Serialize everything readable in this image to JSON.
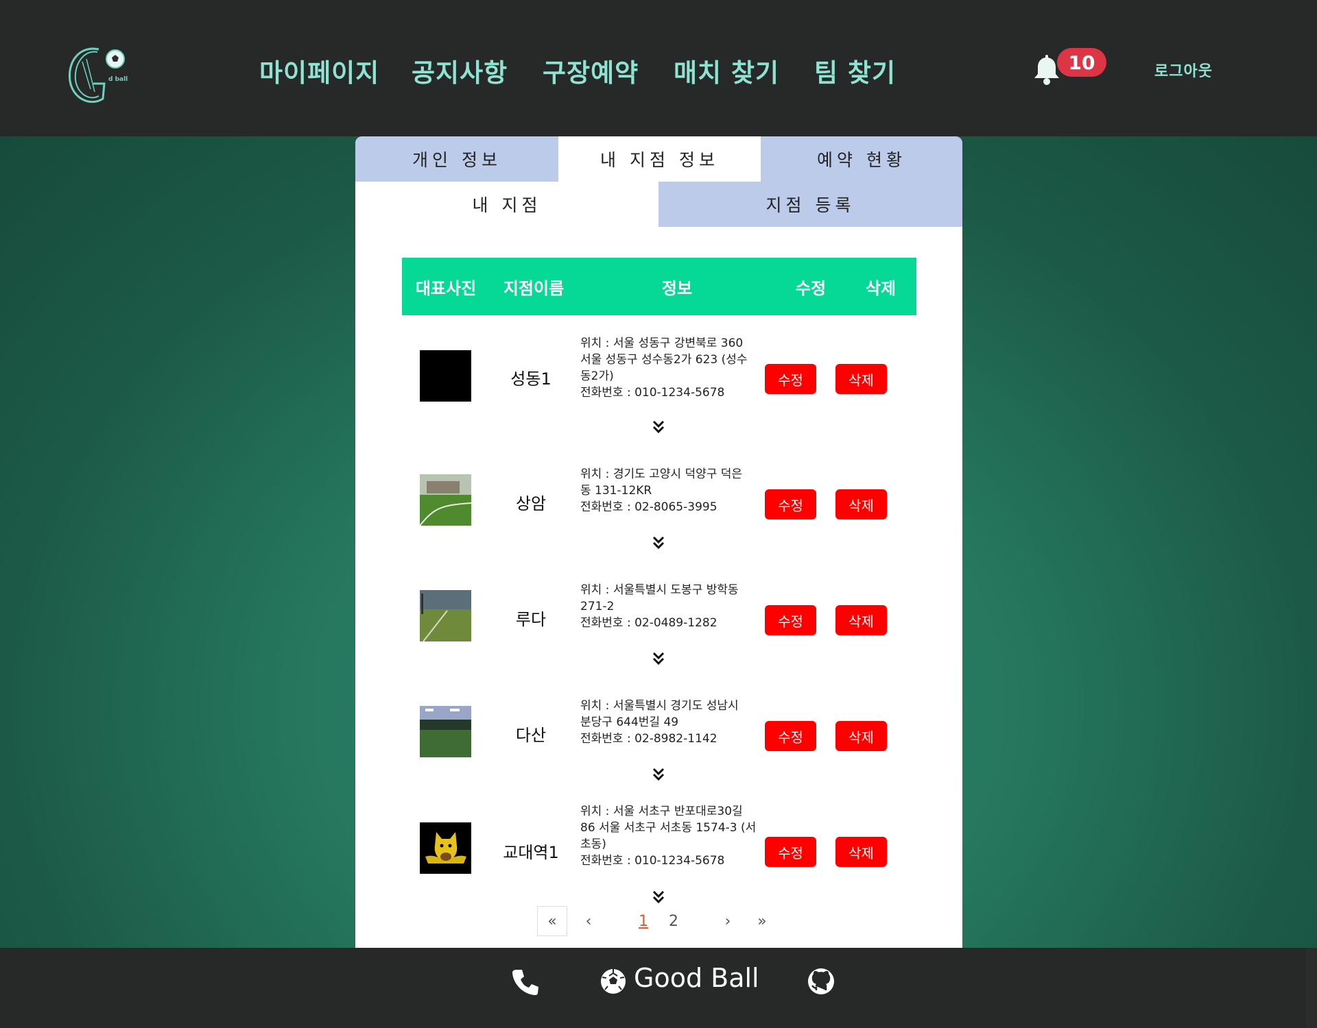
{
  "header": {
    "logo_alt": "Good ball",
    "nav": [
      "마이페이지",
      "공지사항",
      "구장예약",
      "매치 찾기",
      "팀 찾기"
    ],
    "notification_count": "10",
    "logout_label": "로그아웃"
  },
  "tabs": {
    "primary": [
      "개인 정보",
      "내 지점 정보",
      "예약 현황"
    ],
    "primary_active": "내 지점 정보",
    "secondary": [
      "내 지점",
      "지점 등록"
    ],
    "secondary_active": "내 지점"
  },
  "table": {
    "headers": [
      "대표사진",
      "지점이름",
      "정보",
      "수정",
      "삭제"
    ],
    "rows": [
      {
        "name": "성동1",
        "info_lines": [
          "위치 : 서울 성동구 강변북로 360",
          "서울 성동구 성수동2가 623 (성수",
          "동2가)",
          "전화번호 : 010-1234-5678"
        ],
        "edit_label": "수정",
        "delete_label": "삭제",
        "thumb": "black-square"
      },
      {
        "name": "상암",
        "info_lines": [
          "위치 : 경기도 고양시 덕양구 덕은",
          "동 131-12KR",
          "전화번호 : 02-8065-3995"
        ],
        "edit_label": "수정",
        "delete_label": "삭제",
        "thumb": "turf-photo"
      },
      {
        "name": "루다",
        "info_lines": [
          "위치 : 서울특별시 도봉구 방학동",
          "271-2",
          "전화번호 : 02-0489-1282"
        ],
        "edit_label": "수정",
        "delete_label": "삭제",
        "thumb": "turf-photo"
      },
      {
        "name": "다산",
        "info_lines": [
          "위치 : 서울특별시 경기도 성남시",
          "분당구 644번길 49",
          "전화번호 : 02-8982-1142"
        ],
        "edit_label": "수정",
        "delete_label": "삭제",
        "thumb": "night-field-photo"
      },
      {
        "name": "교대역1",
        "info_lines": [
          "위치 : 서울 서초구 반포대로30길",
          "86 서울 서초구 서초동 1574-3 (서",
          "초동)",
          "전화번호 : 010-1234-5678"
        ],
        "edit_label": "수정",
        "delete_label": "삭제",
        "thumb": "character-image"
      }
    ]
  },
  "pagination": {
    "first": "«",
    "prev": "‹",
    "pages": [
      "1",
      "2"
    ],
    "current": "1",
    "next": "›",
    "last": "»"
  },
  "footer": {
    "brand": "Good Ball",
    "icons": [
      "phone-icon",
      "soccer-ball-icon",
      "github-icon"
    ]
  },
  "colors": {
    "header_bg": "#272928",
    "nav_text": "#8fe3d3",
    "badge": "#dc3545",
    "tab_inactive": "#bccbea",
    "table_head": "#06d895",
    "button": "#ff0000",
    "current_page": "#e8572a"
  }
}
